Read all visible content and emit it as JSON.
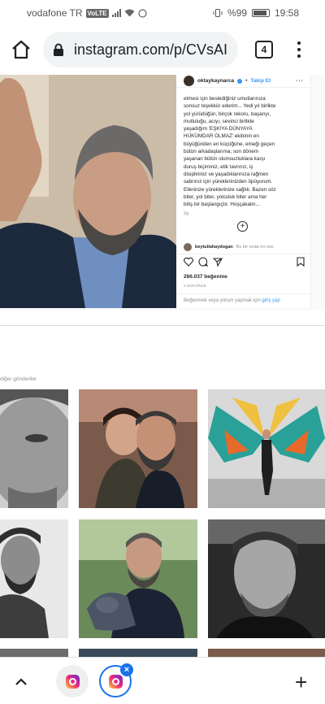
{
  "status_bar": {
    "carrier": "vodafone TR",
    "volte": "VoLTE",
    "battery": "%99",
    "time": "19:58"
  },
  "browser": {
    "url": "instagram.com/p/CVsAI",
    "tab_count": "4"
  },
  "post": {
    "username": "oktaykaynarca",
    "follow_label": "Takip Et",
    "caption_lines": [
      "etmesi için beslediğiniz umutlarınıza",
      "sonsuz teşekkür ederim... Yedi yıl birlikte",
      "yol yürüdüğün, birçok rekoru, başarıyı,",
      "mutluluğu, acıyı, sevinci birlikte",
      "yaşadığım 'EŞKIYA DÜNYAYA",
      "HÜKÜMDAR OLMAZ' ekibinin en",
      "büyüğünden en küçüğüne, emeği geçen",
      "bütün arkadaşlarıma; son dönem",
      "yaşanan bütün olumsuzluklara karşı",
      "duruş biçiminiz, etik tavrınız, iş",
      "disiplininiz ve yaşadıklarınıza rağmen",
      "sabrınız için yüreklerinizden öpüyorum.",
      "Ellerinize yüreklerinize sağlık. Bazen söz",
      "biter, yol biter, yolculuk biter ama her",
      "bitiş bir başlangıçtır. Hoşçakalın..."
    ],
    "caption_time": "2g",
    "comment_user": "beytullahaydogan",
    "comment_text": "Bu bir veda mı reis",
    "likes": "266.037 beğenme",
    "posted_ago": "2 GÜN ÖNCE",
    "add_comment_prefix": "Beğenmek veya yorum yapmak için",
    "login_link": "giriş yap"
  },
  "more_posts_label": "diğer gönderiler",
  "icons": [
    "home-icon",
    "lock-icon",
    "overflow-menu-icon",
    "like-icon",
    "comment-icon",
    "share-icon",
    "save-icon",
    "chevron-up-icon",
    "instagram-icon",
    "close-icon",
    "plus-icon"
  ],
  "colors": {
    "instagram_blue": "#3897f0",
    "chrome_blue": "#1a73e8"
  }
}
